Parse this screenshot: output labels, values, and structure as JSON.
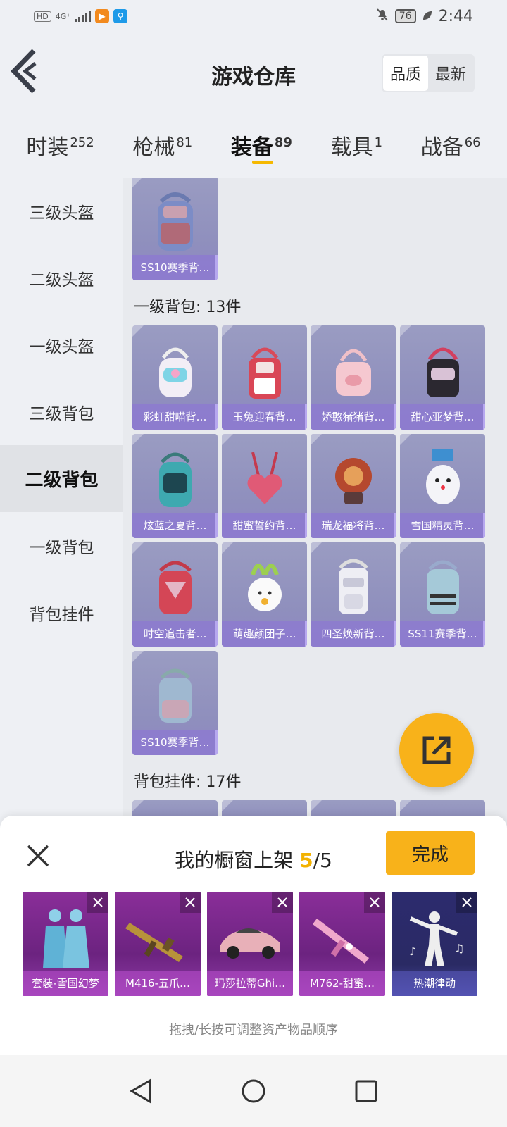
{
  "status_bar": {
    "left_badge": "HD",
    "network": "4G⁺",
    "battery": "76",
    "time": "2:44"
  },
  "header": {
    "title": "游戏仓库",
    "sort_options": [
      "品质",
      "最新"
    ],
    "sort_selected": "品质"
  },
  "tabs": [
    {
      "label": "时装",
      "count": "252"
    },
    {
      "label": "枪械",
      "count": "81"
    },
    {
      "label": "装备",
      "count": "89",
      "active": true
    },
    {
      "label": "载具",
      "count": "1"
    },
    {
      "label": "战备",
      "count": "66"
    }
  ],
  "sidebar": {
    "items": [
      "三级头盔",
      "二级头盔",
      "一级头盔",
      "三级背包",
      "二级背包",
      "一级背包",
      "背包挂件"
    ],
    "active": "二级背包"
  },
  "content": {
    "top_item": "SS10赛季背…",
    "section_level1": {
      "title": "一级背包: 13件",
      "items": [
        "彩虹甜喵背…",
        "玉兔迎春背…",
        "娇憨猪猪背…",
        "甜心亚梦背…",
        "炫蓝之夏背…",
        "甜蜜誓约背…",
        "瑞龙福将背…",
        "雪国精灵背…",
        "时空追击者…",
        "萌趣颜团子…",
        "四圣焕新背…",
        "SS11赛季背…",
        "SS10赛季背…"
      ]
    },
    "section_pendant": {
      "title": "背包挂件: 17件"
    }
  },
  "sheet": {
    "title": "我的橱窗上架",
    "count_current": "5",
    "count_total": "/5",
    "done_label": "完成",
    "items": [
      "套装-雪国幻梦",
      "M416-五爪…",
      "玛莎拉蒂Ghi…",
      "M762-甜蜜…",
      "热潮律动"
    ],
    "hint": "拖拽/长按可调整资产物品顺序"
  },
  "colors": {
    "accent": "#f8b21a",
    "card_purple": "#8f8fbd",
    "showcase_purple": "#7a2a8c"
  }
}
